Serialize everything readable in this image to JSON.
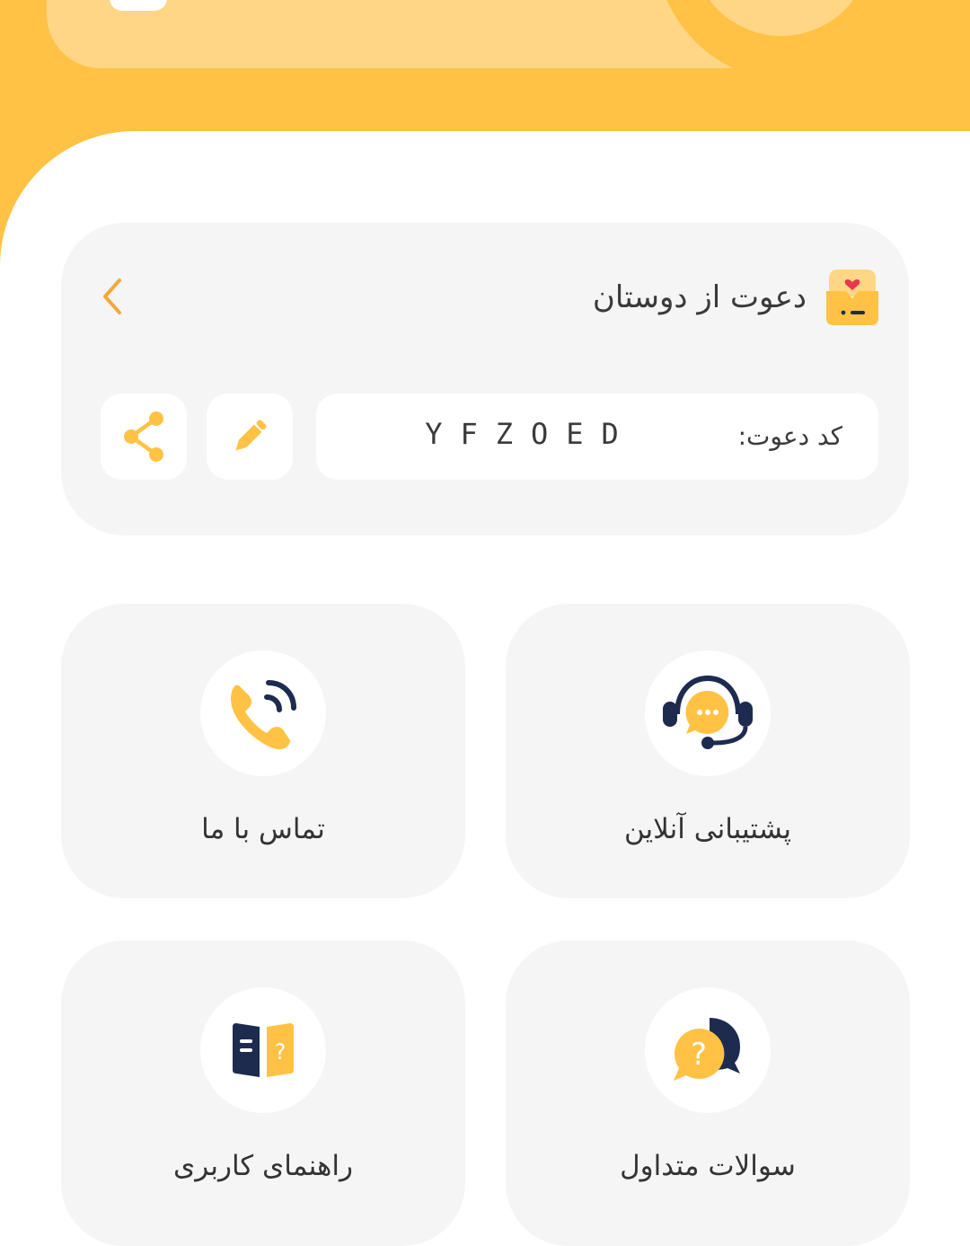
{
  "invite": {
    "title": "دعوت از دوستان",
    "code_label": "کد دعوت:",
    "code_value": "YFZOED"
  },
  "services": [
    {
      "label": "پشتیبانی آنلاین",
      "icon": "headset-chat-icon"
    },
    {
      "label": "تماس با ما",
      "icon": "phone-ringing-icon"
    },
    {
      "label": "سوالات متداول",
      "icon": "faq-chat-icon"
    },
    {
      "label": "راهنمای کاربری",
      "icon": "user-guide-book-icon"
    }
  ],
  "colors": {
    "accent": "#ffc244",
    "accent_light": "#ffd685",
    "navy": "#1d2b4f",
    "card_bg": "#f5f5f5",
    "chevron": "#f2a93b"
  }
}
